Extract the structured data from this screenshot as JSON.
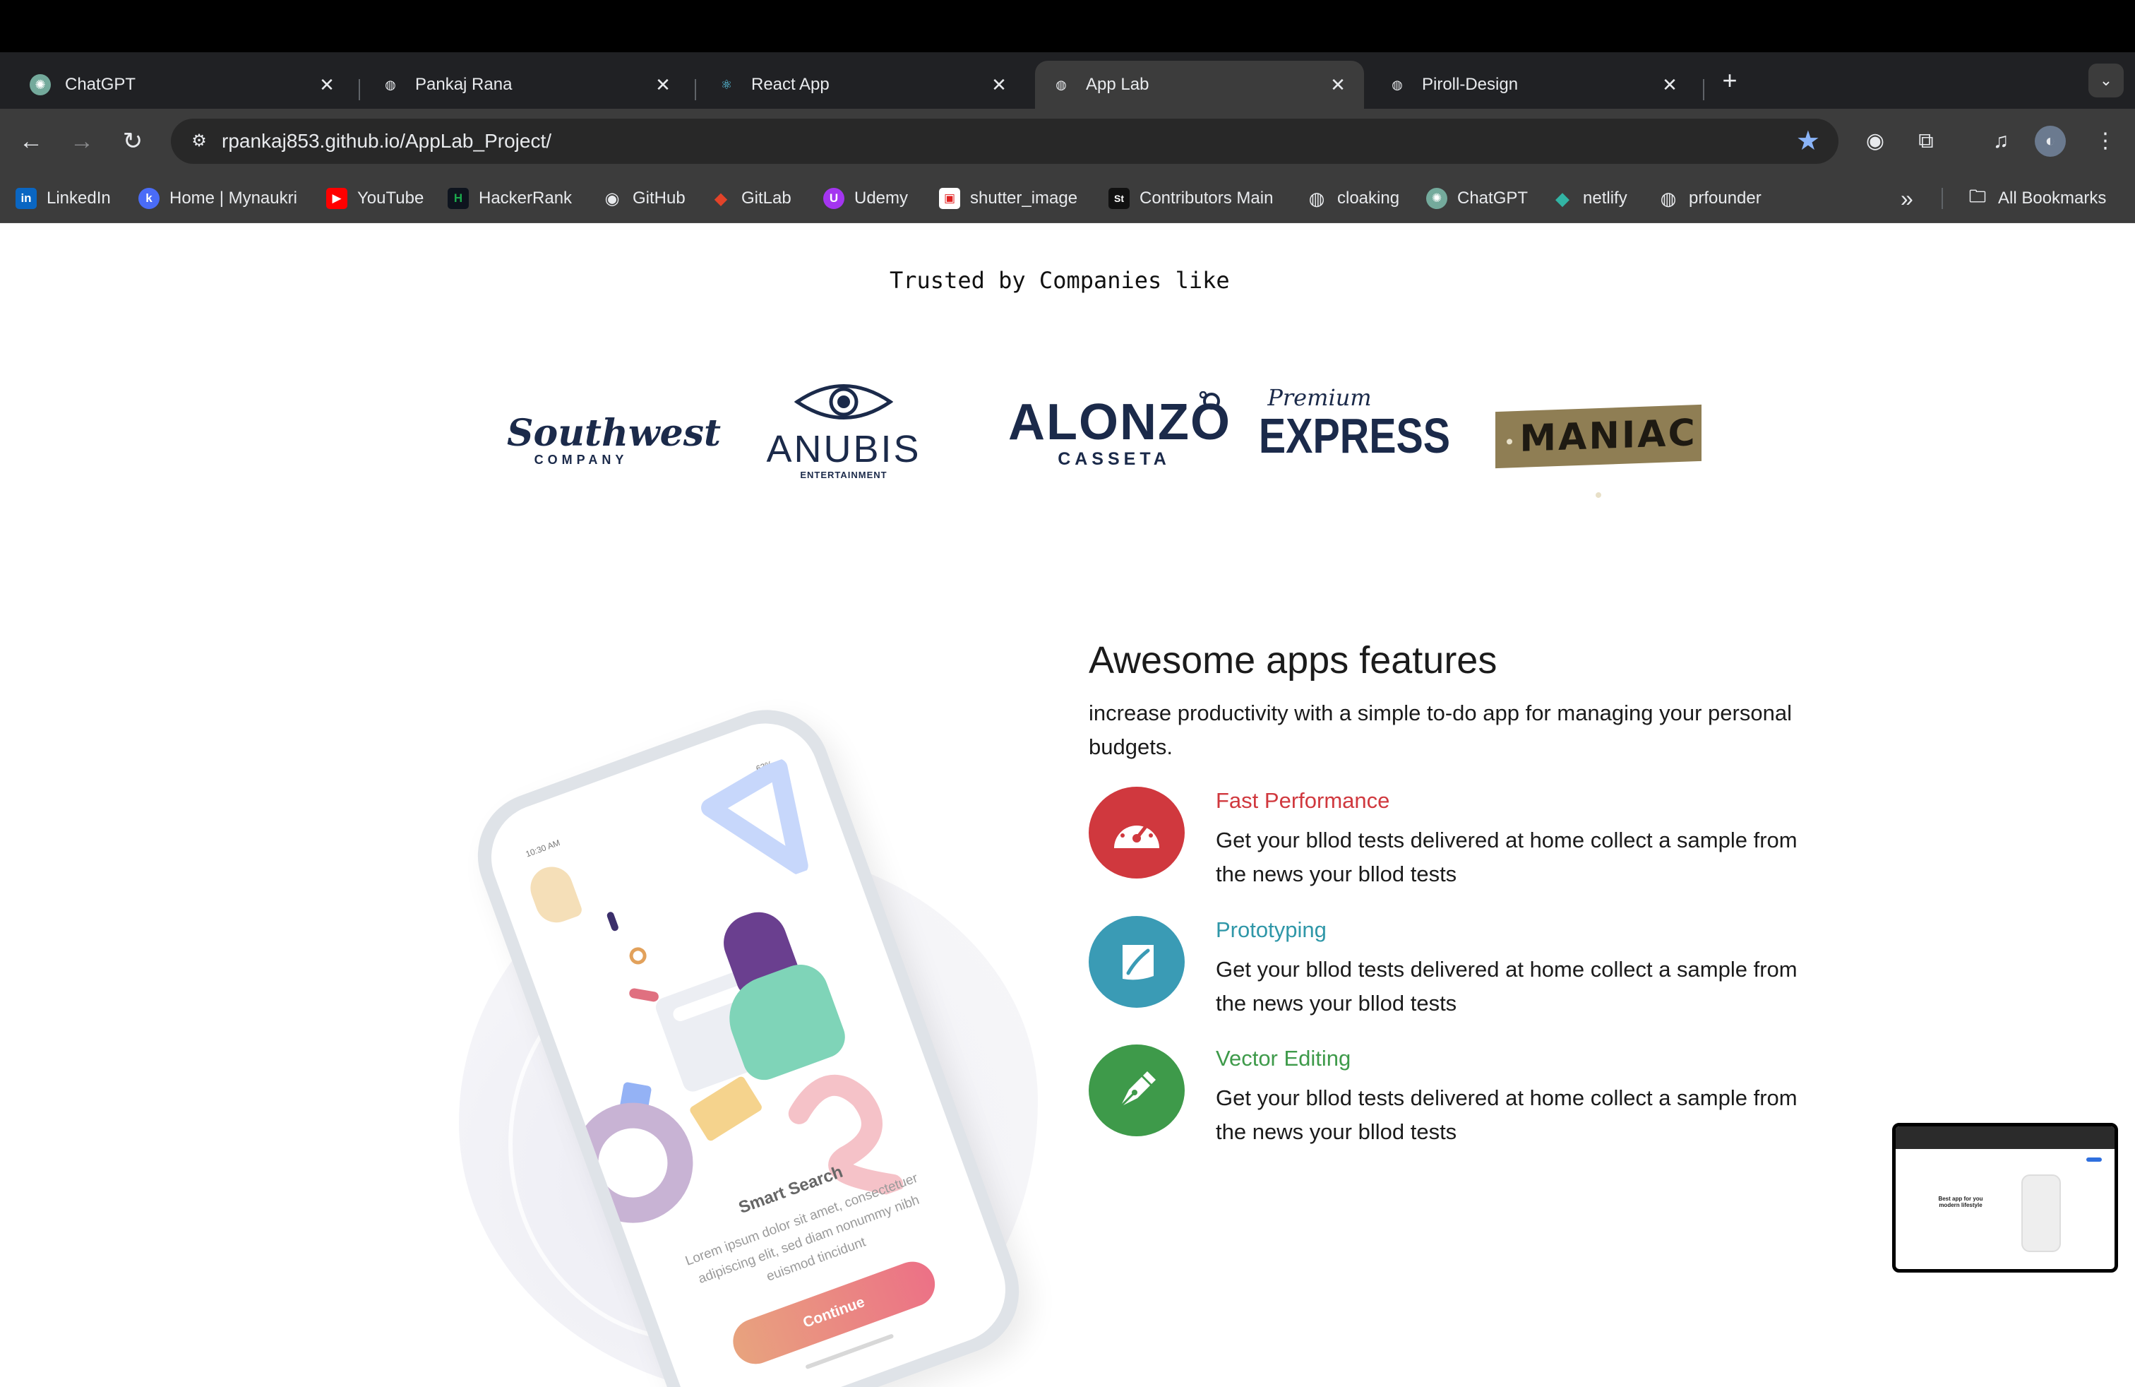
{
  "browser": {
    "tabs": [
      {
        "title": "ChatGPT",
        "icon": "chatgpt-icon",
        "active": false
      },
      {
        "title": "Pankaj Rana",
        "icon": "globe-icon",
        "active": false
      },
      {
        "title": "React App",
        "icon": "react-icon",
        "active": false
      },
      {
        "title": "App Lab",
        "icon": "globe-icon",
        "active": true
      },
      {
        "title": "Piroll-Design",
        "icon": "globe-icon",
        "active": false
      }
    ],
    "close_glyph": "✕",
    "new_tab_glyph": "+",
    "tab_menu_glyph": "⌄",
    "url": "rpankaj853.github.io/AppLab_Project/",
    "bookmarks": [
      {
        "label": "LinkedIn",
        "icon": "linkedin-icon",
        "color": "#0a66c2",
        "glyph": "in"
      },
      {
        "label": "Home | Mynaukri",
        "icon": "mynaukri-icon",
        "color": "#4a6cf7",
        "glyph": "k"
      },
      {
        "label": "YouTube",
        "icon": "youtube-icon",
        "color": "#ff0000",
        "glyph": "▶"
      },
      {
        "label": "HackerRank",
        "icon": "hackerrank-icon",
        "color": "#0e141e",
        "glyph": "H"
      },
      {
        "label": "GitHub",
        "icon": "github-icon",
        "color": "#3c3c3c",
        "glyph": "◉"
      },
      {
        "label": "GitLab",
        "icon": "gitlab-icon",
        "color": "#e24329",
        "glyph": "◆"
      },
      {
        "label": "Udemy",
        "icon": "udemy-icon",
        "color": "#a435f0",
        "glyph": "U"
      },
      {
        "label": "shutter_image",
        "icon": "shutter-icon",
        "color": "#ffffff",
        "glyph": "▣"
      },
      {
        "label": "Contributors Main",
        "icon": "contributors-icon",
        "color": "#111111",
        "glyph": "St"
      },
      {
        "label": "cloaking",
        "icon": "globe-icon",
        "color": "#3c3c3c",
        "glyph": "◍"
      },
      {
        "label": "ChatGPT",
        "icon": "chatgpt-icon",
        "color": "#74aa9c",
        "glyph": "✺"
      },
      {
        "label": "netlify",
        "icon": "netlify-icon",
        "color": "#32b4a4",
        "glyph": "◆"
      },
      {
        "label": "prfounder",
        "icon": "globe-icon",
        "color": "#3c3c3c",
        "glyph": "◍"
      }
    ],
    "overflow_glyph": "»",
    "all_bookmarks": "All Bookmarks"
  },
  "page": {
    "trusted_heading": "Trusted by Companies like",
    "logos": {
      "southwest": {
        "word": "Southwest",
        "sub": "COMPANY"
      },
      "anubis": {
        "word": "ANUBIS",
        "sub": "ENTERTAINMENT"
      },
      "alonzo": {
        "word": "ALONZO",
        "sub": "CASSETA"
      },
      "express": {
        "pre": "Premium",
        "word": "EXPRESS"
      },
      "maniac": {
        "word": "MANIAC"
      }
    },
    "phone": {
      "time": "10:30 AM",
      "status": "63%",
      "title": "Smart Search",
      "desc": "Lorem ipsum dolor sit amet, consectetuer adipiscing elit, sed diam nonummy nibh euismod tincidunt",
      "button": "Continue"
    },
    "features": {
      "heading": "Awesome apps features",
      "intro": "increase productivity with a simple to-do app for managing your personal budgets.",
      "items": [
        {
          "title": "Fast Performance",
          "desc": "Get your bllod tests delivered at home collect a sample from the news your bllod tests",
          "color": "#d0383e",
          "title_color": "#d0383e",
          "icon": "speedometer-icon"
        },
        {
          "title": "Prototyping",
          "desc": "Get your bllod tests delivered at home collect a sample from the news your bllod tests",
          "color": "#3a9bb5",
          "title_color": "#2f97a8",
          "icon": "sketch-icon"
        },
        {
          "title": "Vector Editing",
          "desc": "Get your bllod tests delivered at home collect a sample from the news your bllod tests",
          "color": "#3e9a4a",
          "title_color": "#3e9a4a",
          "icon": "pen-tool-icon"
        }
      ]
    },
    "pip_preview": {
      "title": "Best app for you modern lifestyle"
    }
  }
}
